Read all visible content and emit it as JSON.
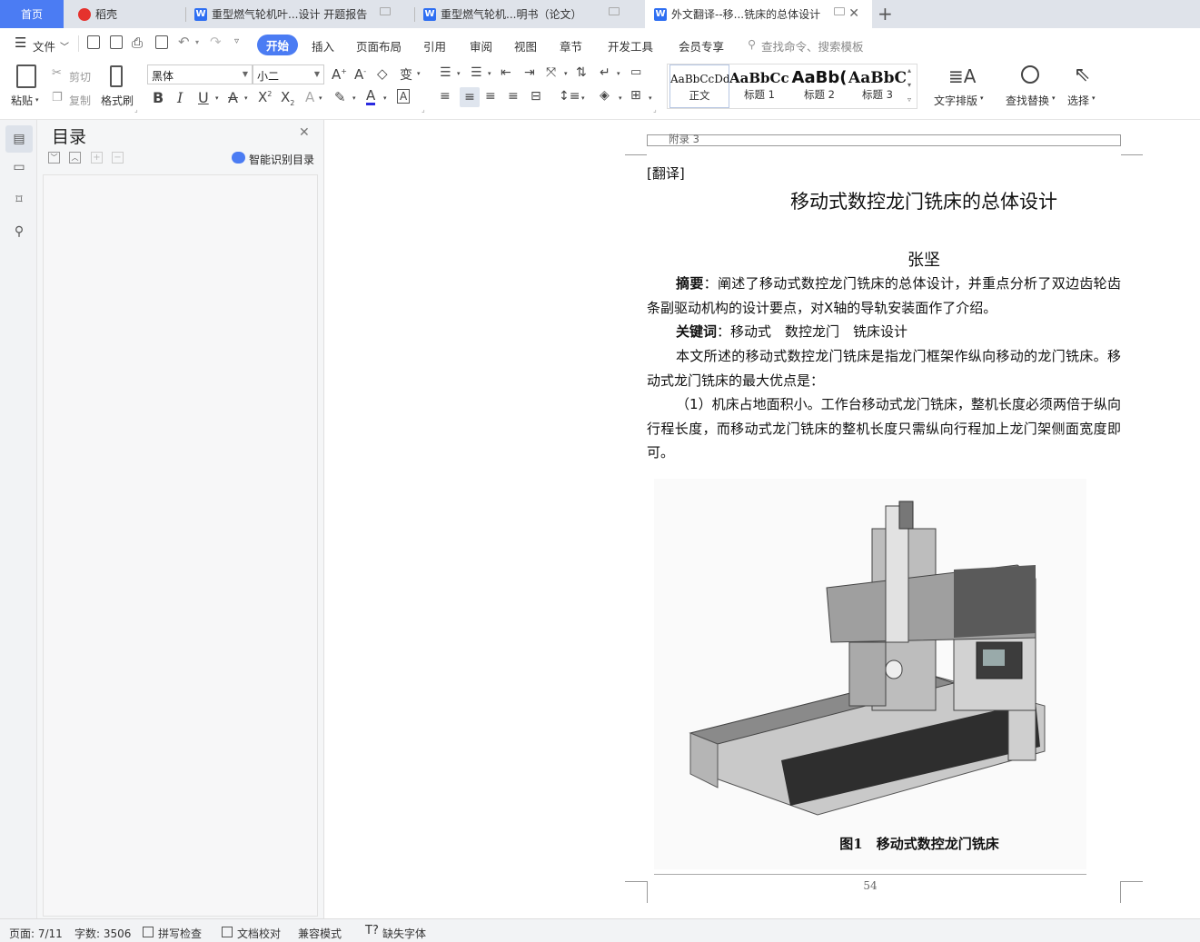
{
  "tabs": {
    "home": "首页",
    "daoke": "稻壳",
    "doc1": "重型燃气轮机叶...设计 开题报告",
    "doc2": "重型燃气轮机...明书（论文）",
    "doc3": "外文翻译--移...铣床的总体设计"
  },
  "menu": {
    "file": "文件",
    "start": "开始",
    "insert": "插入",
    "layout": "页面布局",
    "ref": "引用",
    "review": "审阅",
    "view": "视图",
    "chapter": "章节",
    "dev": "开发工具",
    "member": "会员专享",
    "search": "查找命令、搜索模板"
  },
  "ribbon": {
    "paste": "粘贴",
    "cut": "剪切",
    "copy": "复制",
    "format_painter": "格式刷",
    "font": "黑体",
    "size": "小二",
    "text_layout": "文字排版",
    "find_replace": "查找替换",
    "select": "选择"
  },
  "styles": [
    {
      "sample": "AaBbCcDd",
      "label": "正文"
    },
    {
      "sample": "AaBbCcI",
      "label": "标题 1"
    },
    {
      "sample": "AaBb(",
      "label": "标题 2"
    },
    {
      "sample": "AaBbC",
      "label": "标题 3"
    }
  ],
  "nav": {
    "title": "目录",
    "smart": "智能识别目录"
  },
  "doc": {
    "header": "附录 3",
    "translation_tag": "[翻译]",
    "title": "移动式数控龙门铣床的总体设计",
    "author": "张坚",
    "abstract_label": "摘要",
    "abstract_text": "：阐述了移动式数控龙门铣床的总体设计，并重点分析了双边齿轮齿条副驱动机构的设计要点，对X轴的导轨安装面作了介绍。",
    "keywords_label": "关键词",
    "keywords_text": "：移动式　数控龙门　铣床设计",
    "para1": "本文所述的移动式数控龙门铣床是指龙门框架作纵向移动的龙门铣床。移动式龙门铣床的最大优点是：",
    "para2": "（1）机床占地面积小。工作台移动式龙门铣床，整机长度必须两倍于纵向行程长度，而移动式龙门铣床的整机长度只需纵向行程加上龙门架侧面宽度即可。",
    "figure_caption": "图1　移动式数控龙门铣床",
    "page_number": "54"
  },
  "status": {
    "page": "页面: 7/11",
    "words": "字数: 3506",
    "spell": "拼写检查",
    "proof": "文档校对",
    "compat": "兼容模式",
    "missing_font": "缺失字体"
  }
}
